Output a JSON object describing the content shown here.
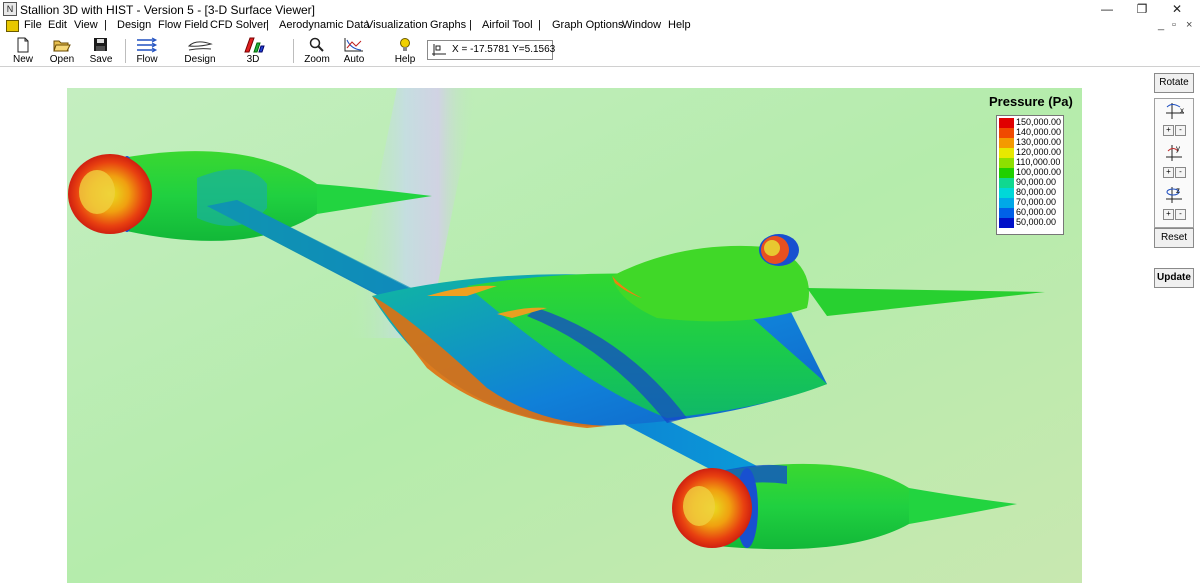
{
  "window": {
    "title": "Stallion 3D with HIST - Version 5 - [3-D Surface Viewer]",
    "controls": {
      "minimize": "—",
      "restore": "❐",
      "close": "✕"
    }
  },
  "menu": {
    "items": [
      "File",
      "Edit",
      "View",
      "|",
      "Design",
      "Flow Field",
      "CFD Solver",
      "|",
      "Aerodynamic Data",
      "Visualization",
      "Graphs",
      "|",
      "Airfoil Tool",
      "|",
      "Graph Options",
      "Window",
      "Help"
    ],
    "mdi_controls": {
      "minimize": "_",
      "restore": "▫",
      "close": "×"
    }
  },
  "toolbar": {
    "new": "New",
    "open": "Open",
    "save": "Save",
    "flow": "Flow",
    "design": "Design",
    "threed": "3D",
    "zoom": "Zoom",
    "auto": "Auto",
    "help": "Help",
    "coordinates": "X = -17.5781  Y=5.1563"
  },
  "legend": {
    "title": "Pressure (Pa)",
    "entries": [
      {
        "label": "150,000.00",
        "color": "#e00000"
      },
      {
        "label": "140,000.00",
        "color": "#f04a00"
      },
      {
        "label": "130,000.00",
        "color": "#f49a00"
      },
      {
        "label": "120,000.00",
        "color": "#e8e800"
      },
      {
        "label": "110,000.00",
        "color": "#8ee000"
      },
      {
        "label": "100,000.00",
        "color": "#20d000"
      },
      {
        "label": "90,000.00",
        "color": "#10d890"
      },
      {
        "label": "80,000.00",
        "color": "#00d8d8"
      },
      {
        "label": "70,000.00",
        "color": "#00a8e8"
      },
      {
        "label": "60,000.00",
        "color": "#0060e8"
      },
      {
        "label": "50,000.00",
        "color": "#0010c8"
      }
    ]
  },
  "side_panel": {
    "rotate": "Rotate",
    "axes": [
      "x",
      "y",
      "z"
    ],
    "plus": "+",
    "minus": "-",
    "reset": "Reset",
    "update": "Update"
  }
}
